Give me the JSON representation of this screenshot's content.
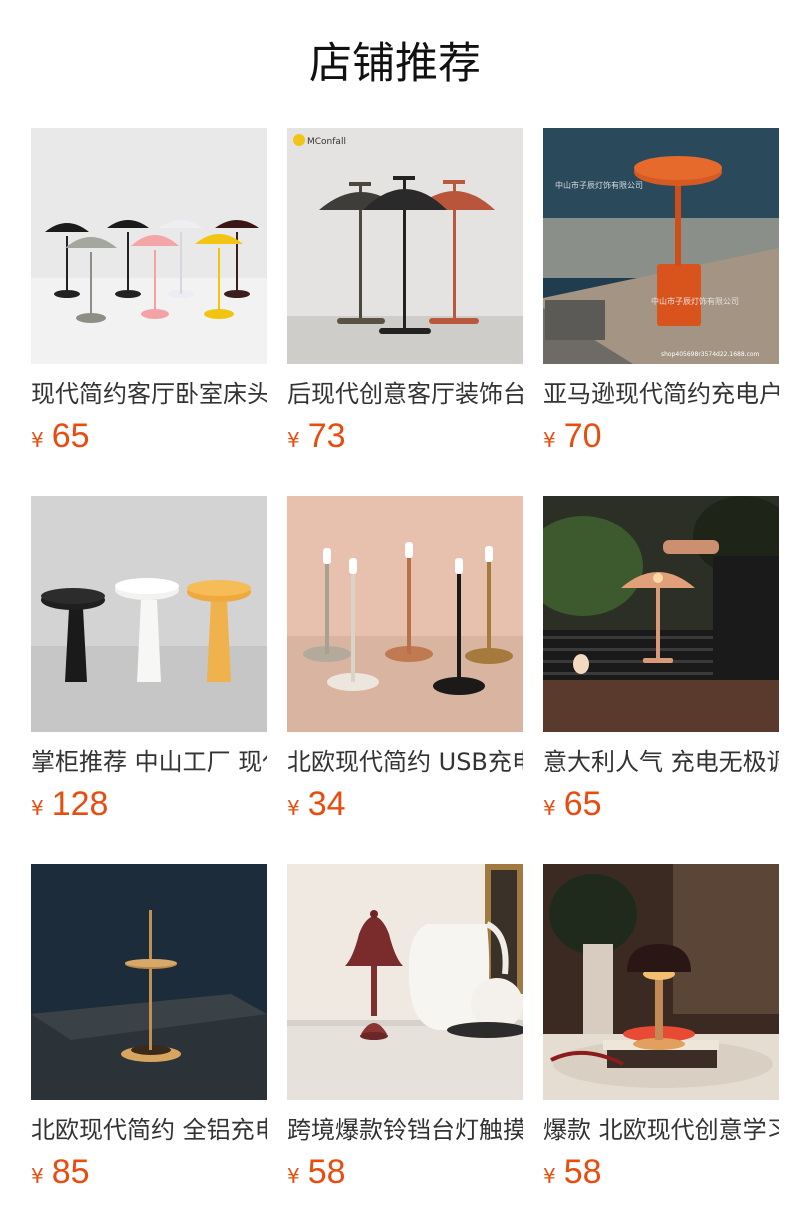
{
  "page": {
    "title": "店铺推荐",
    "currency_symbol": "¥",
    "price_color": "#e84d10"
  },
  "products": [
    {
      "name": "现代简约客厅卧室床头台灯",
      "price": "65",
      "image_icon": "mushroom-lamp-set-image",
      "brand_mark": "",
      "watermarks": []
    },
    {
      "name": "后现代创意客厅装饰台灯",
      "price": "73",
      "image_icon": "dome-table-lamp-image",
      "brand_mark": "MConfall",
      "watermarks": []
    },
    {
      "name": "亚马逊现代简约充电户外台灯",
      "price": "70",
      "image_icon": "orange-outdoor-lamp-image",
      "brand_mark": "",
      "watermarks": [
        "中山市子辰灯饰有限公司",
        "中山市子辰灯饰有限公司",
        "shop405698r3574d22.1688.com"
      ]
    },
    {
      "name": "掌柜推荐 中山工厂 现代台灯",
      "price": "128",
      "image_icon": "mushroom-cap-lamp-image",
      "brand_mark": "",
      "watermarks": []
    },
    {
      "name": "北欧现代简约 USB充电台灯",
      "price": "34",
      "image_icon": "candle-lamp-image",
      "brand_mark": "",
      "watermarks": []
    },
    {
      "name": "意大利人气 充电无极调光台灯",
      "price": "65",
      "image_icon": "copper-outdoor-lamp-image",
      "brand_mark": "",
      "watermarks": []
    },
    {
      "name": "北欧现代简约 全铝充电台灯",
      "price": "85",
      "image_icon": "disc-lamp-image",
      "brand_mark": "",
      "watermarks": []
    },
    {
      "name": "跨境爆款铃铛台灯触摸台灯",
      "price": "58",
      "image_icon": "bell-lamp-image",
      "brand_mark": "",
      "watermarks": []
    },
    {
      "name": "爆款 北欧现代创意学习台灯",
      "price": "58",
      "image_icon": "flowerpot-lamp-image",
      "brand_mark": "",
      "watermarks": []
    }
  ]
}
